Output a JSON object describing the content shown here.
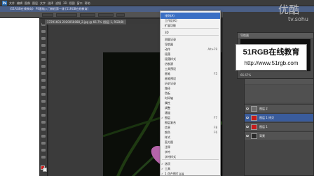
{
  "app": {
    "logo": "Ps",
    "menu": [
      "文件",
      "编辑",
      "图像",
      "图层",
      "文字",
      "选择",
      "滤镜",
      "3D",
      "视图",
      "窗口",
      "帮助"
    ],
    "title": "《51RGB在线教育》 PS基础入门教程第一课 [51RGB在线教育]",
    "doc_tab": "17291601 2020058088_2.jpg @ 66.7% (图层 1, RGB/8)",
    "zoom": "66.67%"
  },
  "dropdown": {
    "items": [
      {
        "label": "排列(A)",
        "shortcut": "",
        "highlighted": true
      },
      {
        "label": "工作区(K)",
        "shortcut": "",
        "highlighted": false
      },
      {
        "label": "扩展功能",
        "shortcut": "",
        "highlighted": false
      },
      {
        "label": "3D",
        "shortcut": "",
        "highlighted": false
      },
      {
        "label": "测量记录",
        "shortcut": "",
        "highlighted": false
      },
      {
        "label": "导航器",
        "shortcut": "",
        "highlighted": false
      },
      {
        "label": "动作",
        "shortcut": "Alt+F9",
        "highlighted": false
      },
      {
        "label": "段落",
        "shortcut": "",
        "highlighted": false
      },
      {
        "label": "段落样式",
        "shortcut": "",
        "highlighted": false
      },
      {
        "label": "仿制源",
        "shortcut": "",
        "highlighted": false
      },
      {
        "label": "工具预设",
        "shortcut": "",
        "highlighted": false
      },
      {
        "label": "画笔",
        "shortcut": "F5",
        "highlighted": false
      },
      {
        "label": "画笔预设",
        "shortcut": "",
        "highlighted": false
      },
      {
        "label": "历史记录",
        "shortcut": "",
        "highlighted": false
      },
      {
        "label": "路径",
        "shortcut": "",
        "highlighted": false
      },
      {
        "label": "色板",
        "shortcut": "",
        "highlighted": false
      },
      {
        "label": "时间轴",
        "shortcut": "",
        "highlighted": false
      },
      {
        "label": "属性",
        "shortcut": "",
        "highlighted": false
      },
      {
        "label": "调整",
        "shortcut": "",
        "highlighted": false
      },
      {
        "label": "通道",
        "shortcut": "",
        "highlighted": false
      },
      {
        "label": "图层",
        "shortcut": "F7",
        "highlighted": false,
        "checked": true
      },
      {
        "label": "图层复合",
        "shortcut": "",
        "highlighted": false
      },
      {
        "label": "信息",
        "shortcut": "F8",
        "highlighted": false
      },
      {
        "label": "颜色",
        "shortcut": "F6",
        "highlighted": false
      },
      {
        "label": "样式",
        "shortcut": "",
        "highlighted": false
      },
      {
        "label": "直方图",
        "shortcut": "",
        "highlighted": false
      },
      {
        "label": "注释",
        "shortcut": "",
        "highlighted": false
      },
      {
        "label": "字符",
        "shortcut": "",
        "highlighted": false
      },
      {
        "label": "字符样式",
        "shortcut": "",
        "highlighted": false
      },
      {
        "label": "选项",
        "shortcut": "",
        "highlighted": false,
        "checked": true
      },
      {
        "label": "工具",
        "shortcut": "",
        "highlighted": false,
        "checked": true
      },
      {
        "label": "1 花卉图片.jpg",
        "shortcut": "",
        "highlighted": false,
        "checked": true
      }
    ]
  },
  "navigator": {
    "tab": "导航器",
    "zoom": "66.67%"
  },
  "layers": {
    "rows": [
      {
        "name": "图层 2",
        "selected": false,
        "thumb_color": "#6b6b6b"
      },
      {
        "name": "图层 1 拷贝",
        "selected": true,
        "thumb_color": "#c61c1c"
      },
      {
        "name": "图层 1",
        "selected": false,
        "thumb_color": "#c61c1c"
      },
      {
        "name": "背景",
        "selected": false,
        "thumb_color": "#2a2a2a"
      }
    ]
  },
  "ad": {
    "title": "51RGB在线教育",
    "url": "http://www.51rgb.com"
  },
  "watermark": {
    "cn": "优酷",
    "en": "tv.sohu"
  },
  "colors": {
    "menu_highlight": "#3a6fc4",
    "foreground": "#d01818",
    "title_bar": "#4b5f86"
  }
}
